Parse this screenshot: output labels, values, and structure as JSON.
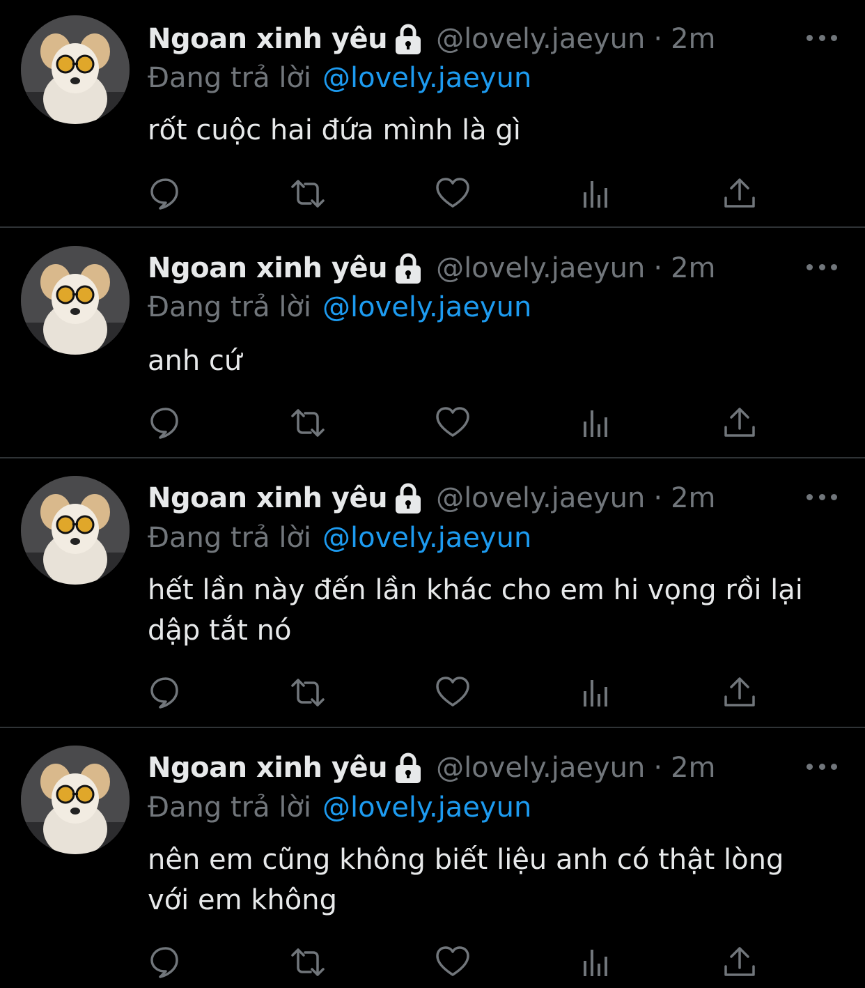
{
  "tweets": [
    {
      "name": "Ngoan xinh yêu",
      "handle": "@lovely.jaeyun",
      "separator": "·",
      "time": "2m",
      "replying_label": "Đang trả lời",
      "replying_to": "@lovely.jaeyun",
      "text": "rốt cuộc hai đứa mình là gì",
      "icons": [
        "lock-icon",
        "more-icon",
        "reply-icon",
        "retweet-icon",
        "like-icon",
        "views-icon",
        "share-icon"
      ]
    },
    {
      "name": "Ngoan xinh yêu",
      "handle": "@lovely.jaeyun",
      "separator": "·",
      "time": "2m",
      "replying_label": "Đang trả lời",
      "replying_to": "@lovely.jaeyun",
      "text": "anh cứ",
      "icons": [
        "lock-icon",
        "more-icon",
        "reply-icon",
        "retweet-icon",
        "like-icon",
        "views-icon",
        "share-icon"
      ]
    },
    {
      "name": "Ngoan xinh yêu",
      "handle": "@lovely.jaeyun",
      "separator": "·",
      "time": "2m",
      "replying_label": "Đang trả lời",
      "replying_to": "@lovely.jaeyun",
      "text": "hết lần này đến lần khác cho em hi vọng rồi lại dập tắt nó",
      "icons": [
        "lock-icon",
        "more-icon",
        "reply-icon",
        "retweet-icon",
        "like-icon",
        "views-icon",
        "share-icon"
      ]
    },
    {
      "name": "Ngoan xinh yêu",
      "handle": "@lovely.jaeyun",
      "separator": "·",
      "time": "2m",
      "replying_label": "Đang trả lời",
      "replying_to": "@lovely.jaeyun",
      "text": "nên em cũng không biết liệu anh có thật lòng với em không",
      "icons": [
        "lock-icon",
        "more-icon",
        "reply-icon",
        "retweet-icon",
        "like-icon",
        "views-icon",
        "share-icon"
      ]
    }
  ],
  "colors": {
    "background": "#000000",
    "text": "#e7e9ea",
    "secondary": "#71767b",
    "accent": "#1d9bf0",
    "divider": "#2f3336"
  }
}
